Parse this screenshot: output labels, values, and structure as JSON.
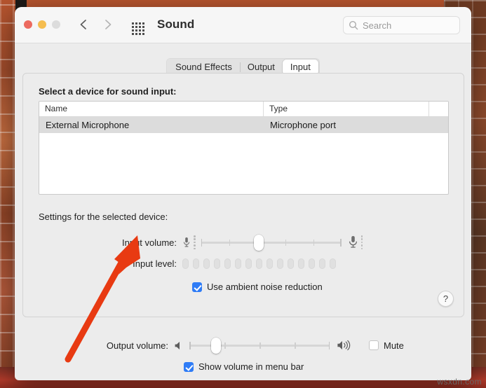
{
  "window": {
    "title": "Sound",
    "traffic_lights": [
      "close",
      "minimize",
      "zoom"
    ],
    "back_icon": "chevron-left-icon",
    "forward_icon": "chevron-right-icon",
    "grid_icon": "grid-apps-icon"
  },
  "search": {
    "placeholder": "Search",
    "value": "",
    "icon": "search-icon"
  },
  "tabs": [
    {
      "label": "Sound Effects",
      "active": false
    },
    {
      "label": "Output",
      "active": false
    },
    {
      "label": "Input",
      "active": true
    }
  ],
  "panel": {
    "select_device_label": "Select a device for sound input:",
    "settings_label": "Settings for the selected device:",
    "table": {
      "columns": [
        "Name",
        "Type",
        ""
      ],
      "rows": [
        {
          "name": "External Microphone",
          "type": "Microphone port",
          "selected": true
        }
      ]
    },
    "input_volume": {
      "label": "Input volume:",
      "value_percent": 41,
      "min_icon": "microphone-small-icon",
      "max_icon": "microphone-large-icon",
      "ticks": 5
    },
    "input_level": {
      "label": "Input level:",
      "segments_total": 15,
      "segments_lit": 0
    },
    "ambient_noise": {
      "label": "Use ambient noise reduction",
      "checked": true
    },
    "help_button": {
      "label": "?",
      "icon": "question-mark-icon"
    }
  },
  "bottom": {
    "output_volume": {
      "label": "Output volume:",
      "value_percent": 19,
      "min_icon": "speaker-low-icon",
      "max_icon": "speaker-high-icon",
      "ticks": 3
    },
    "mute": {
      "label": "Mute",
      "checked": false
    },
    "show_volume": {
      "label": "Show volume in menu bar",
      "checked": true
    }
  },
  "annotation": {
    "arrow_color": "#e83a12",
    "arrow_points_to": "input-volume-slider"
  },
  "watermark": "wsxdn.com",
  "colors": {
    "accent": "#2f7cf6",
    "window_bg": "#ececec",
    "titlebar_bg": "#f6f6f6",
    "selected_row": "#dcdcdc",
    "annotation_red": "#e83a12"
  }
}
